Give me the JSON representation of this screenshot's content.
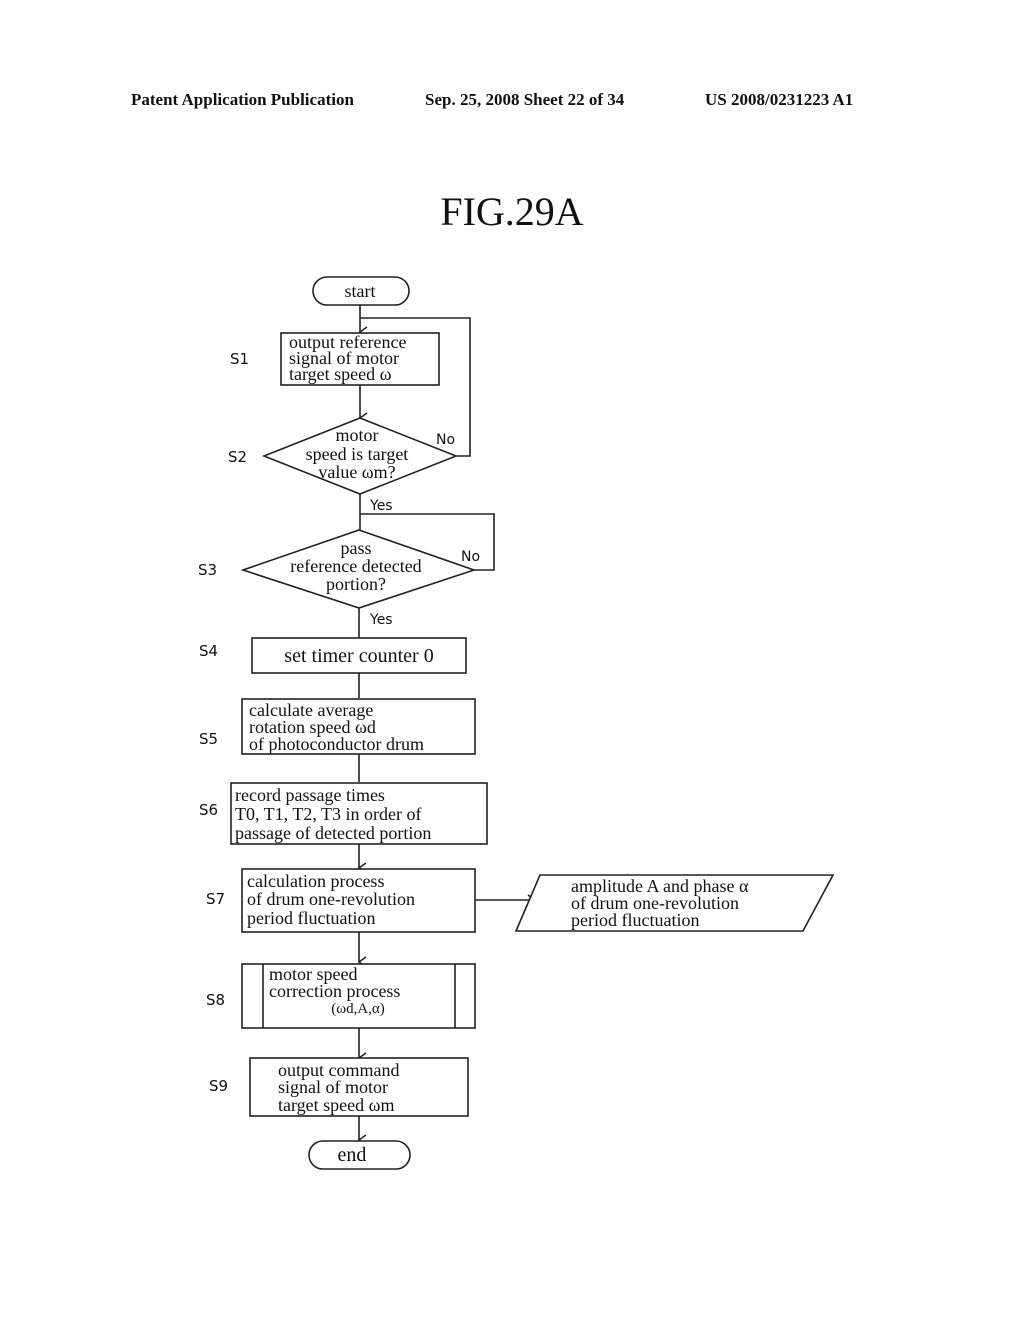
{
  "header": {
    "left": "Patent Application Publication",
    "middle": "Sep. 25, 2008  Sheet 22 of 34",
    "right": "US 2008/0231223 A1"
  },
  "figure": {
    "title": "FIG.29A",
    "terminals": {
      "start": "start",
      "end": "end"
    },
    "steps": [
      {
        "id": "S1",
        "type": "process",
        "lines": [
          "output reference",
          "signal of motor",
          "target speed ω"
        ]
      },
      {
        "id": "S2",
        "type": "decision",
        "lines": [
          "motor",
          "speed is target",
          "value ωm?"
        ],
        "yes": "Yes",
        "no": "No"
      },
      {
        "id": "S3",
        "type": "decision",
        "lines": [
          "pass",
          "reference detected",
          "portion?"
        ],
        "yes": "Yes",
        "no": "No"
      },
      {
        "id": "S4",
        "type": "process",
        "lines": [
          "set timer counter 0"
        ]
      },
      {
        "id": "S5",
        "type": "process",
        "lines": [
          "calculate average",
          "rotation speed ωd",
          "of photoconductor drum"
        ]
      },
      {
        "id": "S6",
        "type": "process",
        "lines": [
          "record passage times",
          "T0, T1, T2, T3 in order of",
          "passage of detected portion"
        ]
      },
      {
        "id": "S7",
        "type": "process",
        "lines": [
          "calculation process",
          "of drum one-revolution",
          "period fluctuation"
        ]
      },
      {
        "id": "S8",
        "type": "predefined",
        "lines": [
          "motor speed",
          "correction process",
          "(ωd,A,α)"
        ]
      },
      {
        "id": "S9",
        "type": "process",
        "lines": [
          "output command",
          "signal of motor",
          "target speed ωm"
        ]
      }
    ],
    "output_data": {
      "lines": [
        "amplitude A and phase α",
        "of drum one-revolution",
        "period fluctuation"
      ]
    }
  }
}
